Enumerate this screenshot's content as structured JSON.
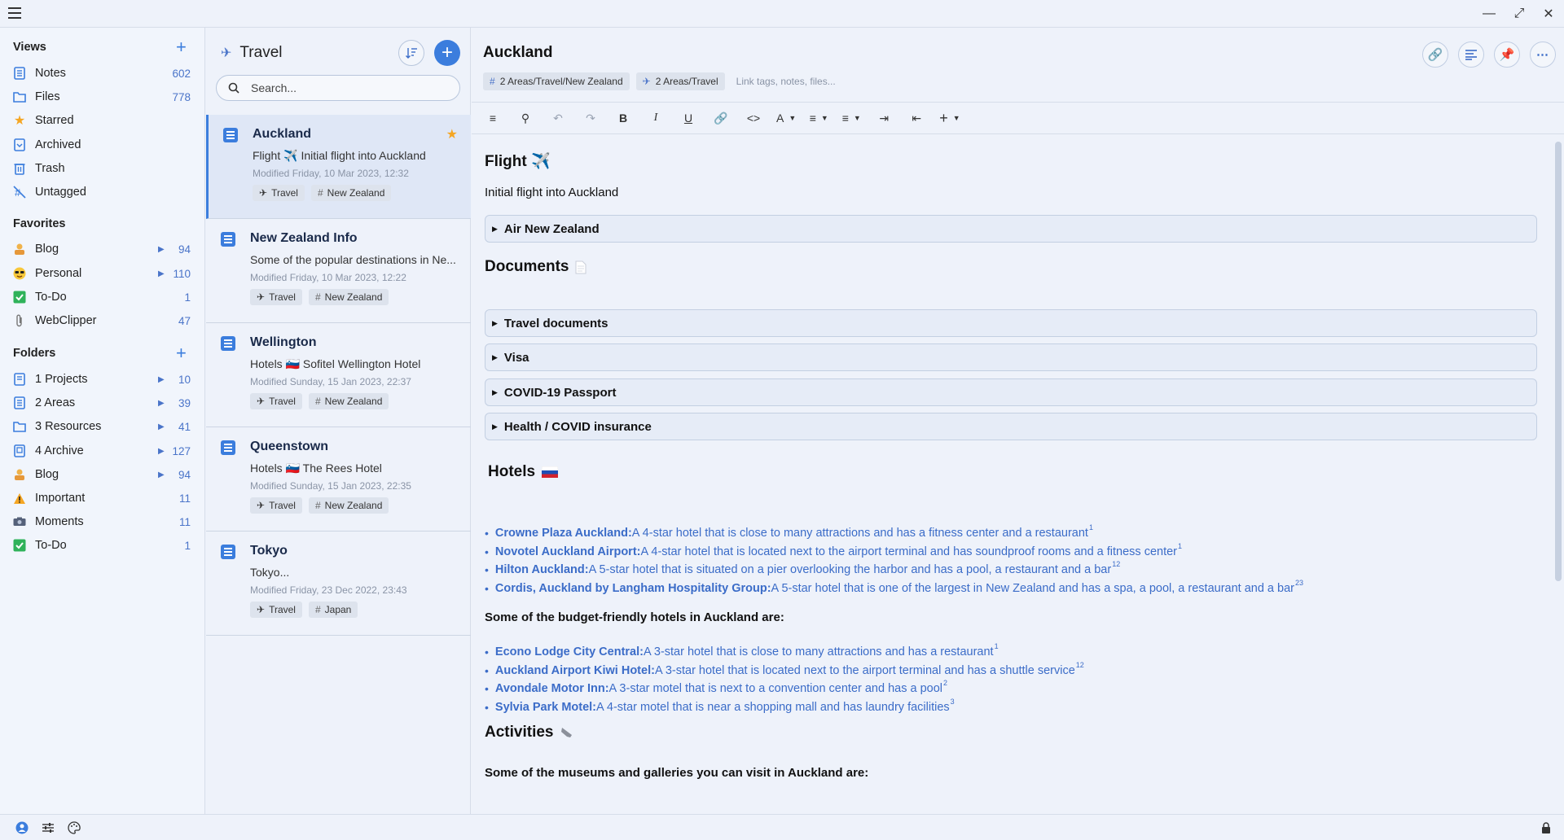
{
  "sidebar": {
    "views_heading": "Views",
    "views": [
      {
        "label": "Notes",
        "count": "602",
        "icon": "notes-icon"
      },
      {
        "label": "Files",
        "count": "778",
        "icon": "folder-icon"
      },
      {
        "label": "Starred",
        "count": "",
        "icon": "star-icon"
      },
      {
        "label": "Archived",
        "count": "",
        "icon": "archive-icon"
      },
      {
        "label": "Trash",
        "count": "",
        "icon": "trash-icon"
      },
      {
        "label": "Untagged",
        "count": "",
        "icon": "untagged-icon"
      }
    ],
    "favorites_heading": "Favorites",
    "favorites": [
      {
        "label": "Blog",
        "count": "94",
        "icon": "blog-emoji-icon"
      },
      {
        "label": "Personal",
        "count": "110",
        "icon": "sunglasses-emoji-icon"
      },
      {
        "label": "To-Do",
        "count": "1",
        "icon": "checkmark-icon"
      },
      {
        "label": "WebClipper",
        "count": "47",
        "icon": "paperclip-icon"
      }
    ],
    "folders_heading": "Folders",
    "folders": [
      {
        "label": "1 Projects",
        "count": "10",
        "icon": "notes-icon"
      },
      {
        "label": "2 Areas",
        "count": "39",
        "icon": "notes-icon"
      },
      {
        "label": "3 Resources",
        "count": "41",
        "icon": "folder-icon"
      },
      {
        "label": "4 Archive",
        "count": "127",
        "icon": "archive-box-icon"
      },
      {
        "label": "Blog",
        "count": "94",
        "icon": "blog-emoji-icon"
      },
      {
        "label": "Important",
        "count": "11",
        "icon": "warning-icon"
      },
      {
        "label": "Moments",
        "count": "11",
        "icon": "camera-icon"
      },
      {
        "label": "To-Do",
        "count": "1",
        "icon": "checkmark-icon"
      }
    ]
  },
  "notelist": {
    "title": "Travel",
    "search_placeholder": "Search...",
    "notes": [
      {
        "title": "Auckland",
        "snippet": "Flight ✈️ Initial flight into Auckland",
        "date": "Modified Friday, 10 Mar 2023, 12:32",
        "tags": [
          "Travel",
          "New Zealand"
        ],
        "starred": true
      },
      {
        "title": "New Zealand Info",
        "snippet": "Some of the popular destinations in Ne...",
        "date": "Modified Friday, 10 Mar 2023, 12:22",
        "tags": [
          "Travel",
          "New Zealand"
        ],
        "starred": false
      },
      {
        "title": "Wellington",
        "snippet": "Hotels 🇸🇮 Sofitel Wellington Hotel",
        "date": "Modified Sunday, 15 Jan 2023, 22:37",
        "tags": [
          "Travel",
          "New Zealand"
        ],
        "starred": false
      },
      {
        "title": "Queenstown",
        "snippet": "Hotels 🇸🇮 The Rees Hotel",
        "date": "Modified Sunday, 15 Jan 2023, 22:35",
        "tags": [
          "Travel",
          "New Zealand"
        ],
        "starred": false
      },
      {
        "title": "Tokyo",
        "snippet": "Tokyo...",
        "date": "Modified Friday, 23 Dec 2022, 23:43",
        "tags": [
          "Travel",
          "Japan"
        ],
        "starred": false
      }
    ]
  },
  "editor": {
    "title": "Auckland",
    "tags": [
      "2 Areas/Travel/New Zealand",
      "2 Areas/Travel"
    ],
    "link_placeholder": "Link tags, notes, files...",
    "flight_heading": "Flight ✈️",
    "flight_text": "Initial flight into Auckland",
    "flight_details": "Air New Zealand",
    "documents_heading": "Documents",
    "documents": [
      "Travel documents",
      "Visa",
      "COVID-19 Passport",
      "Health / COVID insurance"
    ],
    "hotels_heading": "Hotels",
    "hotels": [
      {
        "name": "Crowne Plaza Auckland:",
        "desc": " A 4-star hotel that is close to many attractions and has a fitness center and a restaurant",
        "sup": "1"
      },
      {
        "name": "Novotel Auckland Airport:",
        "desc": " A 4-star hotel that is located next to the airport terminal and has soundproof rooms and a fitness center",
        "sup": "1"
      },
      {
        "name": "Hilton Auckland:",
        "desc": " A 5-star hotel that is situated on a pier overlooking the harbor and has a pool, a restaurant and a bar",
        "sup": "12"
      },
      {
        "name": "Cordis, Auckland by Langham Hospitality Group:",
        "desc": " A 5-star hotel that is one of the largest in New Zealand and has a spa, a pool, a restaurant and a bar",
        "sup": "23"
      }
    ],
    "budget_text": "Some of the budget-friendly hotels in Auckland are:",
    "budget_hotels": [
      {
        "name": "Econo Lodge City Central:",
        "desc": " A 3-star hotel that is close to many attractions and has a restaurant",
        "sup": "1"
      },
      {
        "name": "Auckland Airport Kiwi Hotel:",
        "desc": " A 3-star hotel that is located next to the airport terminal and has a shuttle service",
        "sup": "12"
      },
      {
        "name": "Avondale Motor Inn:",
        "desc": " A 3-star motel that is next to a convention center and has a pool",
        "sup": "2"
      },
      {
        "name": "Sylvia Park Motel:",
        "desc": " A 4-star motel that is near a shopping mall and has laundry facilities",
        "sup": "3"
      }
    ],
    "activities_heading": "Activities",
    "museums_text": "Some of the museums and galleries you can visit in Auckland are:"
  },
  "colors": {
    "accent": "#3b7ddd",
    "link": "#3b6cc8",
    "star": "#f5a623",
    "background": "#eef2fa"
  }
}
